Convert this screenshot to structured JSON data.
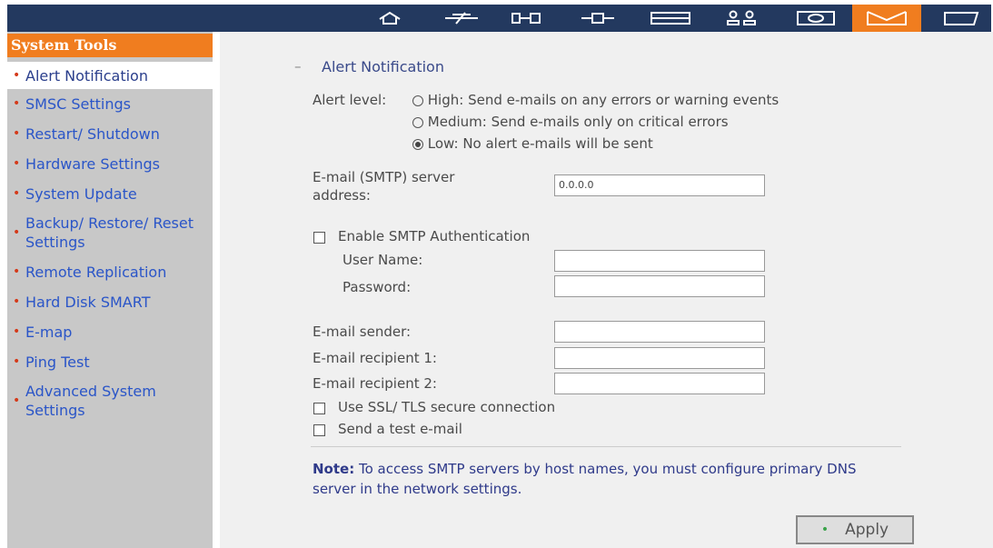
{
  "toolbar": {
    "icons": [
      "home-icon",
      "network-icon",
      "device-icon",
      "link-icon",
      "disk-icon",
      "users-icon",
      "monitor-icon",
      "tools-icon",
      "logout-icon"
    ],
    "active_index": 7,
    "accent": "#f07d1f",
    "bar_color": "#23395f"
  },
  "sidebar": {
    "title": "System Tools",
    "items": [
      {
        "label": "Alert Notification"
      },
      {
        "label": "SMSC Settings"
      },
      {
        "label": "Restart/ Shutdown"
      },
      {
        "label": "Hardware Settings"
      },
      {
        "label": "System Update"
      },
      {
        "label_line1": "Backup/ Restore/ Reset",
        "label_line2": "Settings"
      },
      {
        "label": "Remote Replication"
      },
      {
        "label": "Hard Disk SMART"
      },
      {
        "label": "E-map"
      },
      {
        "label": "Ping Test"
      },
      {
        "label_line1": "Advanced System",
        "label_line2": "Settings"
      }
    ]
  },
  "main": {
    "section_title": "Alert Notification",
    "alert_level_label": "Alert level:",
    "alert_options": [
      {
        "label": "High: Send e-mails on any errors or warning events",
        "checked": false
      },
      {
        "label": "Medium: Send e-mails only on critical errors",
        "checked": false
      },
      {
        "label": "Low: No alert e-mails will be sent",
        "checked": true
      }
    ],
    "smtp_server_label_line1": "E-mail (SMTP) server",
    "smtp_server_label_line2": "address:",
    "smtp_server_value": "0.0.0.0",
    "enable_auth_label": "Enable SMTP Authentication",
    "username_label": "User Name:",
    "password_label": "Password:",
    "sender_label": "E-mail sender:",
    "recipient1_label": "E-mail recipient 1:",
    "recipient2_label": "E-mail recipient 2:",
    "ssl_label": "Use SSL/ TLS secure connection",
    "test_email_label": "Send a test e-mail",
    "note_bold": "Note:",
    "note_line1": " To access SMTP servers by host names, you must configure primary DNS",
    "note_line2": "server in the network settings.",
    "apply_label": "Apply"
  }
}
